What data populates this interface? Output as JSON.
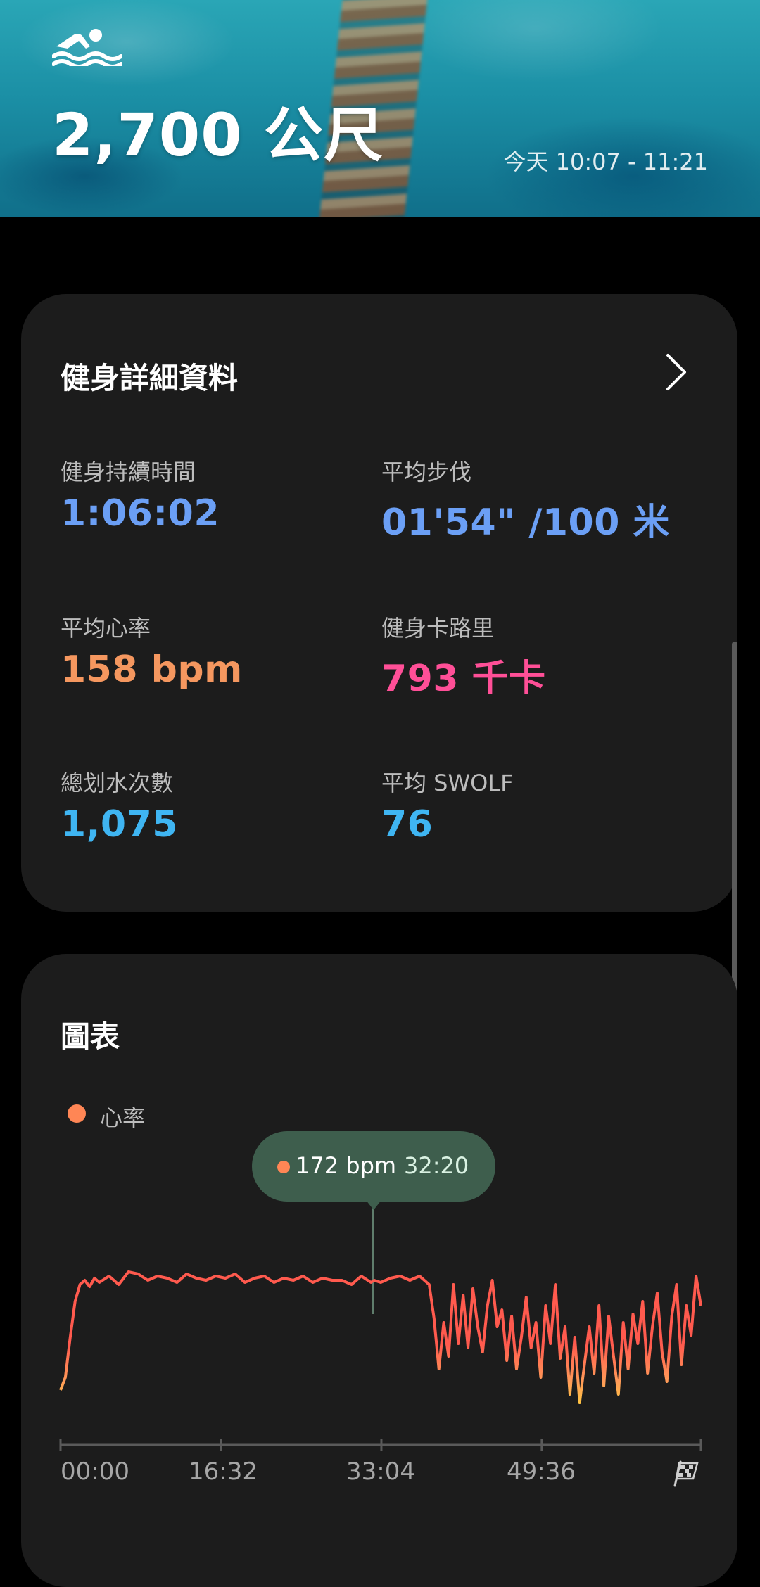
{
  "header": {
    "activity_icon": "swimming-icon",
    "distance": "2,700 公尺",
    "time_range": "今天 10:07 - 11:21"
  },
  "details": {
    "title": "健身詳細資料",
    "chevron_icon": "chevron-right-icon",
    "stats": [
      {
        "label": "健身持續時間",
        "value": "1:06:02",
        "color": "#6b9ff5"
      },
      {
        "label": "平均步伐",
        "value": "01'54\" /100 米",
        "color": "#6b9ff5"
      },
      {
        "label": "平均心率",
        "value": "158 bpm",
        "color": "#f5975f"
      },
      {
        "label": "健身卡路里",
        "value": "793 千卡",
        "color": "#ff4f97"
      },
      {
        "label": "總划水次數",
        "value": "1,075",
        "color": "#3fb5f2"
      },
      {
        "label": "平均 SWOLF",
        "value": "76",
        "color": "#3fb5f2"
      }
    ]
  },
  "chart_section": {
    "title": "圖表",
    "legend_label": "心率",
    "legend_color": "#ff8655",
    "tooltip": {
      "value": "172 bpm",
      "time": "32:20"
    },
    "finish_icon": "checkered-flag-icon"
  },
  "chart_data": {
    "type": "line",
    "series": [
      {
        "name": "心率",
        "x": [
          0,
          0.5,
          1,
          1.5,
          2,
          2.5,
          3,
          3.5,
          4,
          5,
          6,
          7,
          8,
          9,
          10,
          11,
          12,
          13,
          14,
          15,
          16,
          17,
          18,
          19,
          20,
          21,
          22,
          23,
          24,
          25,
          26,
          27,
          28,
          29,
          30,
          31,
          32,
          32.33,
          33,
          34,
          35,
          36,
          37,
          38,
          38.5,
          39,
          39.5,
          40,
          40.5,
          41,
          41.5,
          42,
          42.5,
          43,
          43.5,
          44,
          44.5,
          45,
          45.5,
          46,
          46.5,
          47,
          47.5,
          48,
          48.5,
          49,
          49.5,
          50,
          50.5,
          51,
          51.5,
          52,
          52.5,
          53,
          53.5,
          54,
          54.5,
          55,
          55.5,
          56,
          56.5,
          57,
          57.5,
          58,
          58.5,
          59,
          59.5,
          60,
          60.5,
          61,
          61.5,
          62,
          62.5,
          63,
          63.5,
          64,
          64.5,
          65,
          65.5,
          66
        ],
        "y": [
          120,
          126,
          145,
          162,
          170,
          172,
          169,
          173,
          171,
          174,
          170,
          176,
          175,
          172,
          174,
          173,
          171,
          175,
          173,
          172,
          174,
          173,
          175,
          171,
          173,
          174,
          171,
          173,
          172,
          174,
          171,
          173,
          172,
          172,
          170,
          174,
          171,
          172,
          171,
          173,
          174,
          172,
          174,
          170,
          154,
          130,
          152,
          136,
          170,
          142,
          165,
          140,
          168,
          150,
          138,
          160,
          172,
          150,
          158,
          134,
          155,
          130,
          145,
          164,
          140,
          152,
          126,
          160,
          142,
          170,
          135,
          150,
          118,
          145,
          114,
          132,
          150,
          128,
          160,
          122,
          155,
          136,
          118,
          152,
          130,
          156,
          142,
          162,
          128,
          150,
          166,
          138,
          124,
          155,
          170,
          132,
          160,
          146,
          174,
          160
        ],
        "color_low": "#ffd23a",
        "color_high": "#ff5a4e"
      }
    ],
    "x_ticks": [
      "00:00",
      "16:32",
      "33:04",
      "49:36"
    ],
    "x_range": [
      0,
      66
    ],
    "y_range": [
      110,
      180
    ],
    "legend_placement": "top-left",
    "highlight": {
      "x": 32.33,
      "y": 172
    }
  }
}
